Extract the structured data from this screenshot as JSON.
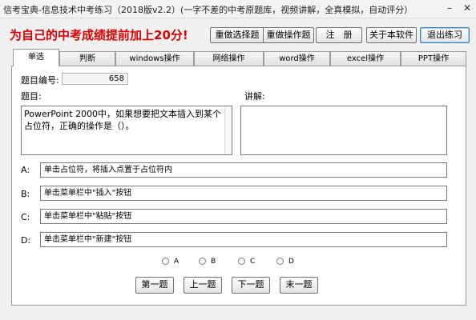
{
  "window": {
    "title": "信考宝典-信息技术中考练习（2018版v2.2）(一字不差的中考原题库，视频讲解，全真模拟，自动评分）",
    "minimize_glyph": "–",
    "close_glyph": "✕"
  },
  "slogan": "为自己的中考成绩提前加上20分!",
  "toolbar": {
    "reset_choice": "重做选择题",
    "reset_operation": "重做操作题",
    "register": "注　册",
    "about": "关于本软件",
    "exit": "退出练习"
  },
  "tabs": [
    "单选",
    "判断",
    "windows操作",
    "网络操作",
    "word操作",
    "excel操作",
    "PPT操作"
  ],
  "question": {
    "number_label": "题目编号:",
    "number_value": "658",
    "question_label": "题目:",
    "explain_label": "讲解:",
    "text": "PowerPoint 2000中，如果想要把文本插入到某个占位符，正确的操作是（）。",
    "explanation": ""
  },
  "options": [
    {
      "letter": "A:",
      "text": "单击占位符，将插入点置于占位符内"
    },
    {
      "letter": "B:",
      "text": "单击菜单栏中\"插入\"按钮"
    },
    {
      "letter": "C:",
      "text": "单击菜单栏中\"粘贴\"按钮"
    },
    {
      "letter": "D:",
      "text": "单击菜单栏中\"新建\"按钮"
    }
  ],
  "answers": [
    "A",
    "B",
    "C",
    "D"
  ],
  "nav": {
    "first": "第一题",
    "prev": "上一题",
    "next": "下一题",
    "last": "末一题"
  }
}
